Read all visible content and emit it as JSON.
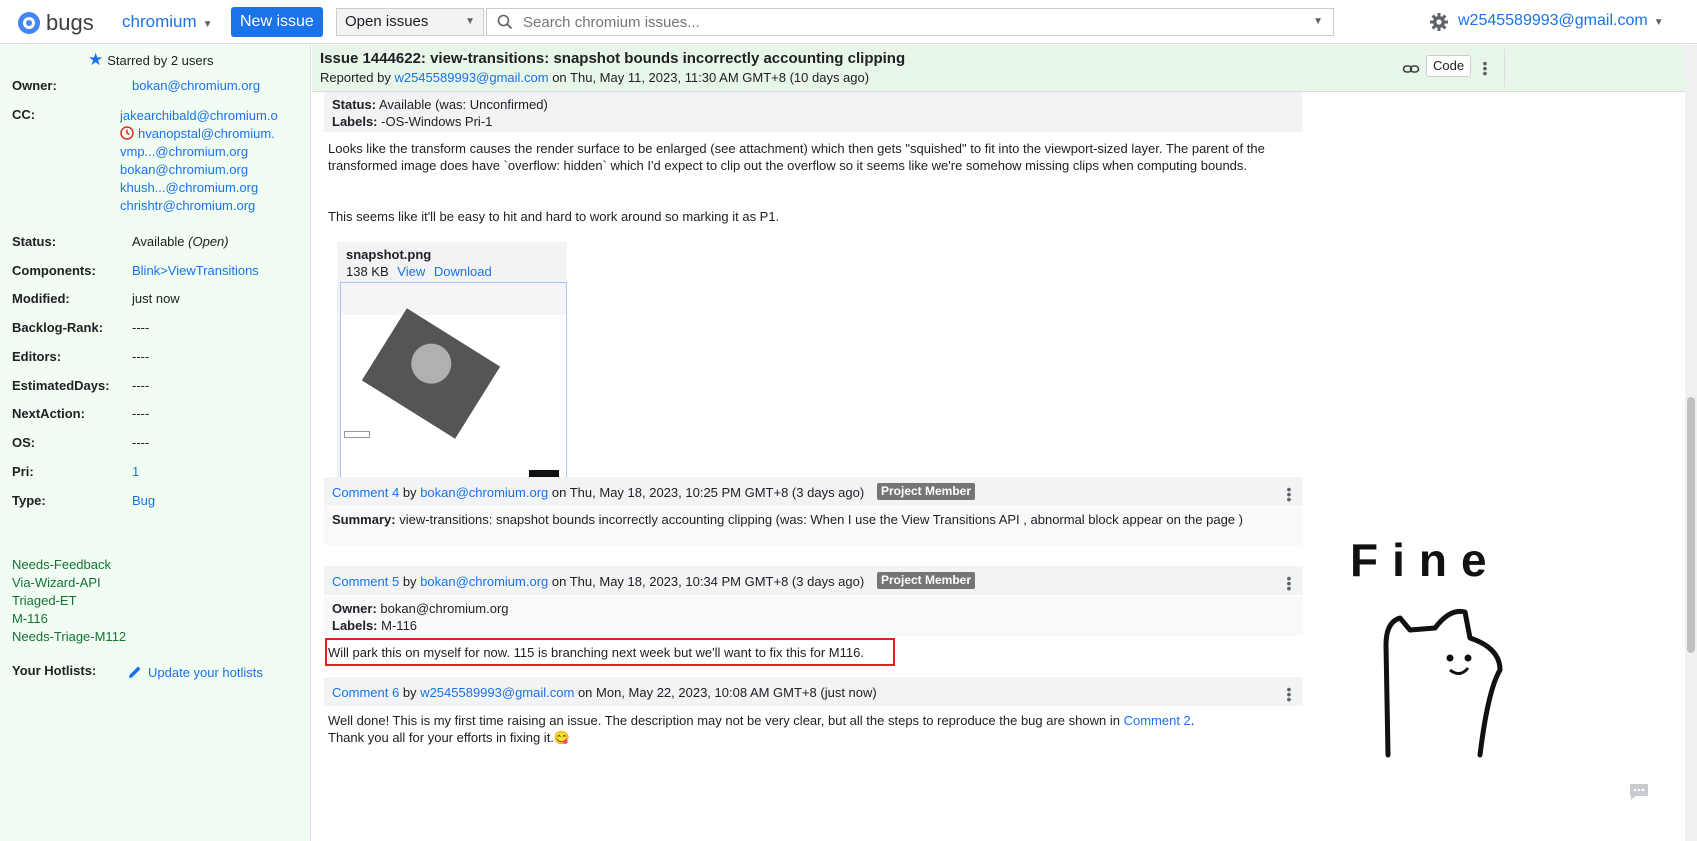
{
  "topbar": {
    "logo_text": "bugs",
    "project": "chromium",
    "new_issue": "New issue",
    "scope": "Open issues",
    "search_placeholder": "Search chromium issues...",
    "account": "w2545589993@gmail.com"
  },
  "sidebar": {
    "starred": "Starred by 2 users",
    "owner_label": "Owner:",
    "owner": "bokan@chromium.org",
    "cc_label": "CC:",
    "cc": [
      "jakearchibald@chromium.o",
      "hvanopstal@chromium.",
      "vmp...@chromium.org",
      "bokan@chromium.org",
      "khush...@chromium.org",
      "chrishtr@chromium.org"
    ],
    "status_label": "Status:",
    "status_value": "Available",
    "status_state": "(Open)",
    "components_label": "Components:",
    "components": "Blink>ViewTransitions",
    "modified_label": "Modified:",
    "modified": "just now",
    "backlog_label": "Backlog-Rank:",
    "backlog": "----",
    "editors_label": "Editors:",
    "editors": "----",
    "estimated_label": "EstimatedDays:",
    "estimated": "----",
    "nextaction_label": "NextAction:",
    "nextaction": "----",
    "os_label": "OS:",
    "os": "----",
    "pri_label": "Pri:",
    "pri": "1",
    "type_label": "Type:",
    "type": "Bug",
    "labels": [
      "Needs-Feedback",
      "Via-Wizard-API",
      "Triaged-ET",
      "M-116",
      "Needs-Triage-M112"
    ],
    "hotlists_label": "Your Hotlists:",
    "hotlists_link": "Update your hotlists"
  },
  "issue": {
    "title": "Issue 1444622: view-transitions: snapshot bounds incorrectly accounting clipping",
    "reported_prefix": "Reported by",
    "reporter": "w2545589993@gmail.com",
    "reported_suffix": "on Thu, May 11, 2023, 11:30 AM GMT+8 (10 days ago)",
    "code_btn": "Code"
  },
  "comment3": {
    "status_label": "Status:",
    "status_text": "Available (was: Unconfirmed)",
    "labels_label": "Labels:",
    "labels_text": "-OS-Windows Pri-1",
    "body1": "Looks like the transform causes the render surface to be enlarged (see attachment) which then gets \"squished\" to fit into the viewport-sized layer. The parent of the transformed image does have `overflow: hidden` which I'd expect to clip out the overflow so it seems like we're somehow missing clips when computing bounds.",
    "body2": "This seems like it'll be easy to hit and hard to work around so marking it as P1.",
    "attachment_name": "snapshot.png",
    "attachment_size": "138 KB",
    "view": "View",
    "download": "Download"
  },
  "comment4": {
    "link": "Comment 4",
    "by": "by",
    "author": "bokan@chromium.org",
    "date": "on Thu, May 18, 2023, 10:25 PM GMT+8 (3 days ago)",
    "badge": "Project Member",
    "summary_label": "Summary:",
    "summary_text": "view-transitions: snapshot bounds incorrectly accounting clipping (was: When I use the View Transitions API , abnormal block appear on the page )"
  },
  "comment5": {
    "link": "Comment 5",
    "by": "by",
    "author": "bokan@chromium.org",
    "date": "on Thu, May 18, 2023, 10:34 PM GMT+8 (3 days ago)",
    "badge": "Project Member",
    "owner_label": "Owner:",
    "owner_text": "bokan@chromium.org",
    "labels_label": "Labels:",
    "labels_text": "M-116",
    "body": "Will park this on myself for now. 115 is branching next week but we'll want to fix this for M116."
  },
  "comment6": {
    "link": "Comment 6",
    "by": "by",
    "author": "w2545589993@gmail.com",
    "date": "on Mon, May 22, 2023, 10:08 AM GMT+8 (just now)",
    "body_prefix": "Well done! This is my first time raising an issue. The description may not be very clear, but all the steps to reproduce the bug are shown in",
    "body_link": "Comment 2",
    "body_suffix": ".",
    "body_line2": "Thank you all for your efforts in fixing it.",
    "emoji": "😋"
  },
  "doodle_text": "Fine",
  "colors": {
    "accent": "#1a73e8",
    "sidebar_bg": "#f1fcf3",
    "header_bg": "#e8f5e9",
    "label_green": "#137333",
    "highlight": "#e02020"
  }
}
